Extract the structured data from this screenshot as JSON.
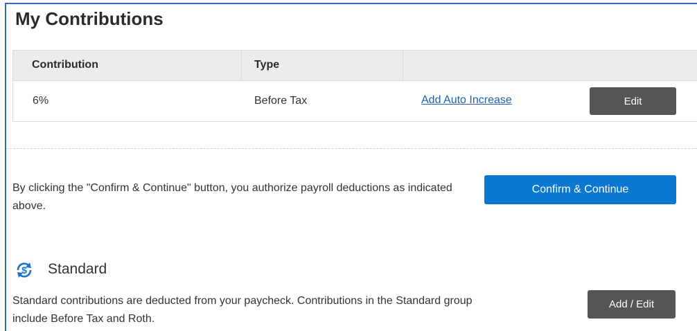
{
  "page": {
    "title": "My Contributions"
  },
  "table": {
    "headers": [
      "Contribution",
      "Type",
      ""
    ],
    "row": {
      "contribution": "6%",
      "type": "Before Tax",
      "auto_increase_link": "Add Auto Increase",
      "edit_label": "Edit"
    }
  },
  "authorization": {
    "text": "By clicking the \"Confirm & Continue\" button, you authorize payroll deductions as indicated above.",
    "confirm_label": "Confirm & Continue"
  },
  "standard": {
    "icon": "dollar-cycle-icon",
    "title": "Standard",
    "description": "Standard contributions are deducted from your paycheck. Contributions in the Standard group include Before Tax and Roth.",
    "add_edit_label": "Add / Edit"
  },
  "colors": {
    "accent_blue": "#0a78d1",
    "dark_button": "#555555",
    "link": "#1f5fb0",
    "header_bg": "#ececec"
  }
}
